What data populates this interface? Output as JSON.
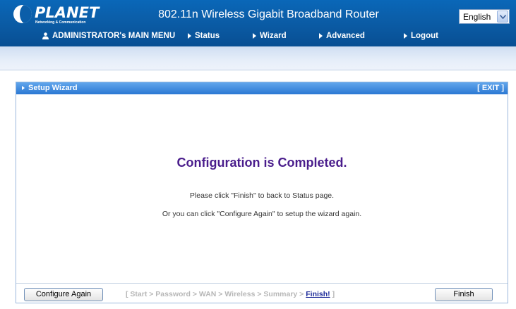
{
  "header": {
    "logo_text": "PLANET",
    "logo_subtext": "Networking & Communication",
    "title": "802.11n Wireless Gigabit Broadband Router",
    "language": "English"
  },
  "menu": {
    "admin": "ADMINISTRATOR's MAIN MENU",
    "status": "Status",
    "wizard": "Wizard",
    "advanced": "Advanced",
    "logout": "Logout"
  },
  "panel": {
    "title": "Setup Wizard",
    "exit": "[ EXIT ]",
    "heading": "Configuration is Completed.",
    "message1": "Please click \"Finish\" to back to Status page.",
    "message2": "Or you can click \"Configure Again\" to setup the wizard again."
  },
  "footer": {
    "configure_again": "Configure Again",
    "finish": "Finish",
    "steps_prefix": "[ Start > Password > WAN > Wireless > Summary > ",
    "steps_current": "Finish!",
    "steps_suffix": " ]"
  }
}
